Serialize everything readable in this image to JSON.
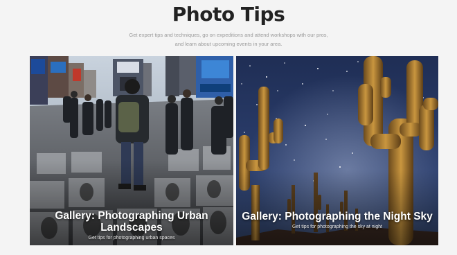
{
  "page": {
    "title": "Photo Tips",
    "subtitle": "Get expert tips and techniques, go on expeditions and attend workshops with our pros, and learn about upcoming events in your area."
  },
  "cards": [
    {
      "title": "Gallery: Photographing Urban Landscapes",
      "subtitle": "Get tips for photographing urban spaces",
      "image_icon": "times-square-street-photo"
    },
    {
      "title": "Gallery: Photographing the Night Sky",
      "subtitle": "Get tips for photographing the sky at night",
      "image_icon": "saguaro-cactus-night-sky-photo"
    }
  ]
}
